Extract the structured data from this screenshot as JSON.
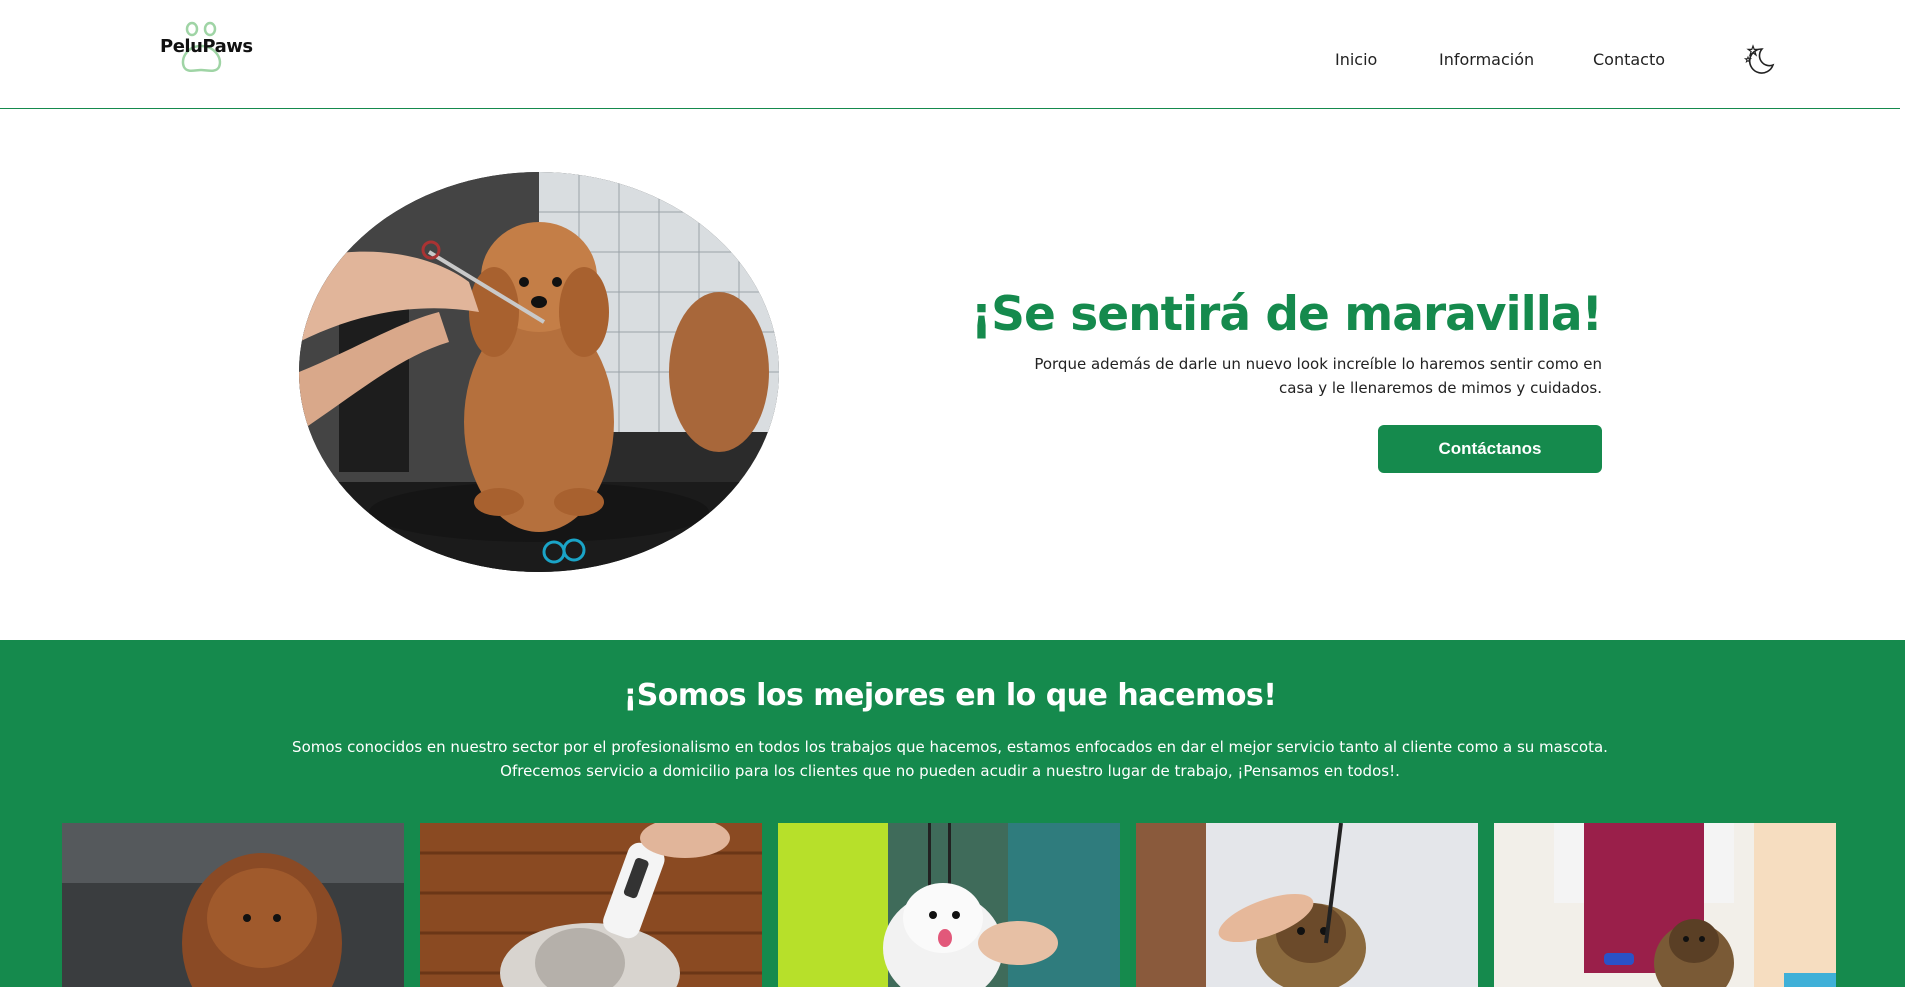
{
  "brand": {
    "name": "PeluPaws",
    "logo_icon": "paw-icon"
  },
  "nav": {
    "items": [
      "Inicio",
      "Información",
      "Contacto"
    ],
    "theme_toggle_icon": "moon-stars-icon"
  },
  "hero": {
    "title": "¡Se sentirá de maravilla!",
    "description": "Porque además de darle un nuevo look increíble lo haremos sentir como en casa y le llenaremos de mimos y cuidados.",
    "cta_label": "Contáctanos",
    "image": "dog-being-groomed-photo"
  },
  "about": {
    "title": "¡Somos los mejores en lo que hacemos!",
    "description_line1": "Somos conocidos en nuestro sector por el profesionalismo en todos los trabajos que hacemos, estamos enfocados en dar el mejor servicio tanto al cliente como a su mascota.",
    "description_line2": "Ofrecemos servicio a domicilio para los clientes que no pueden acudir a nuestro lugar de trabajo, ¡Pensamos en todos!.",
    "gallery": [
      "poodle-photo",
      "dog-trimmer-photo",
      "white-dog-grooming-photo",
      "yorkie-brushing-photo",
      "yorkie-groomer-photo"
    ]
  },
  "colors": {
    "accent": "#158a4d",
    "text": "#1a1a1a",
    "background": "#ffffff"
  }
}
